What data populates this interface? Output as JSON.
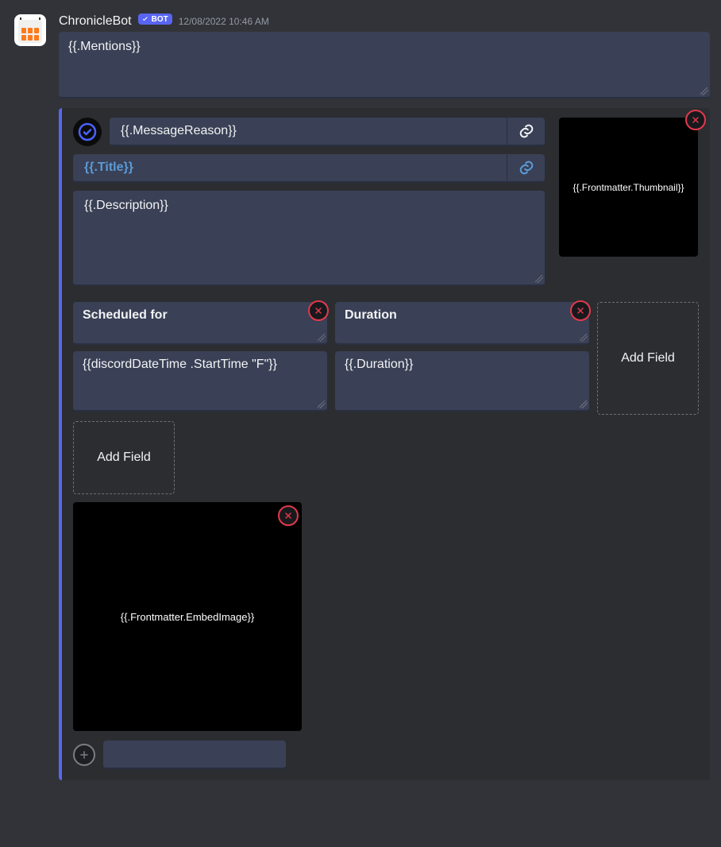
{
  "header": {
    "bot_name": "ChronicleBot",
    "bot_tag": "BOT",
    "timestamp": "12/08/2022 10:46 AM"
  },
  "content_box": "{{.Mentions}}",
  "embed": {
    "author": "{{.MessageReason}}",
    "title": "{{.Title}}",
    "description": "{{.Description}}",
    "thumbnail": "{{.Frontmatter.Thumbnail}}",
    "image": "{{.Frontmatter.EmbedImage}}",
    "fields": [
      {
        "name": "Scheduled for",
        "value": "{{discordDateTime .StartTime \"F\"}}"
      },
      {
        "name": "Duration",
        "value": "{{.Duration}}"
      }
    ],
    "add_field_label": "Add Field"
  }
}
